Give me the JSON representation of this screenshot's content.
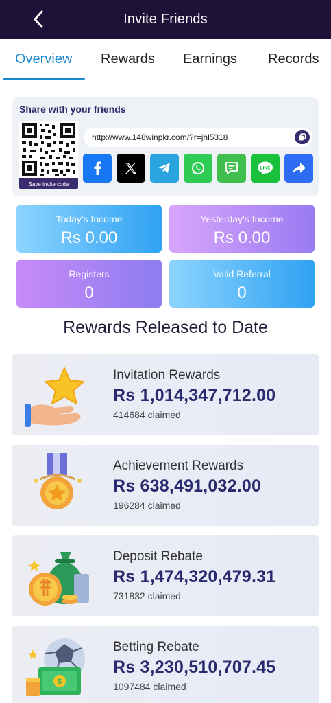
{
  "header": {
    "title": "Invite Friends"
  },
  "tabs": [
    {
      "label": "Overview",
      "active": true
    },
    {
      "label": "Rewards",
      "active": false
    },
    {
      "label": "Earnings",
      "active": false
    },
    {
      "label": "Records",
      "active": false
    }
  ],
  "share": {
    "title": "Share with your friends",
    "link": "http://www.148winpkr.com/?r=jhl5318",
    "save_label": "Save invite code",
    "platforms": [
      {
        "name": "facebook-icon",
        "color": "#1877f2"
      },
      {
        "name": "x-icon",
        "color": "#000000"
      },
      {
        "name": "telegram-icon",
        "color": "#2aa4de"
      },
      {
        "name": "whatsapp-icon",
        "color": "#2ecc55"
      },
      {
        "name": "sms-icon",
        "color": "#3fbf4e"
      },
      {
        "name": "line-icon",
        "color": "#18c03b"
      },
      {
        "name": "share-icon",
        "color": "#2e6cf4"
      }
    ]
  },
  "stats": {
    "today_income": {
      "label": "Today's Income",
      "value": "Rs  0.00"
    },
    "yesterday_income": {
      "label": "Yesterday's Income",
      "value": "Rs  0.00"
    },
    "registers": {
      "label": "Registers",
      "value": "0"
    },
    "valid_referral": {
      "label": "Valid Referral",
      "value": "0"
    }
  },
  "rewards_section": {
    "title": "Rewards Released to Date"
  },
  "rewards": [
    {
      "name": "Invitation Rewards",
      "amount": "Rs 1,014,347,712.00",
      "claimed": "414684 claimed",
      "icon": "star-hand-icon"
    },
    {
      "name": "Achievement Rewards",
      "amount": "Rs 638,491,032.00",
      "claimed": "196284 claimed",
      "icon": "medal-icon"
    },
    {
      "name": "Deposit Rebate",
      "amount": "Rs 1,474,320,479.31",
      "claimed": "731832 claimed",
      "icon": "money-bag-icon"
    },
    {
      "name": "Betting Rebate",
      "amount": "Rs 3,230,510,707.45",
      "claimed": "1097484 claimed",
      "icon": "cash-ball-icon"
    }
  ]
}
